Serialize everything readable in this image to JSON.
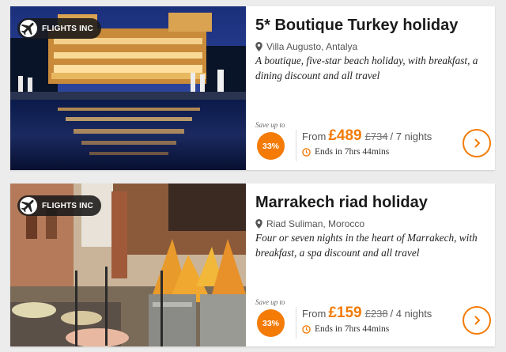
{
  "colors": {
    "accent": "#f37b06",
    "background": "#ececec"
  },
  "cards": [
    {
      "badge": "FLIGHTS INC",
      "badge_icon": "airplane-icon",
      "title": "5* Boutique Turkey holiday",
      "location": "Villa Augusto, Antalya",
      "description": "A boutique, five-star beach holiday, with breakfast, a dining discount and all travel",
      "save_label": "Save up to",
      "discount": "33%",
      "from_label": "From",
      "price": "£489",
      "old_price": "£734",
      "duration": "/ 7 nights",
      "ends": "Ends in 7hrs 44mins"
    },
    {
      "badge": "FLIGHTS INC",
      "badge_icon": "airplane-icon",
      "title": "Marrakech riad holiday",
      "location": "Riad Suliman, Morocco",
      "description": "Four or seven nights in the heart of Marrakech, with breakfast, a spa discount and all travel",
      "save_label": "Save up to",
      "discount": "33%",
      "from_label": "From",
      "price": "£159",
      "old_price": "£238",
      "duration": "/ 4 nights",
      "ends": "Ends in 7hrs 44mins"
    }
  ]
}
